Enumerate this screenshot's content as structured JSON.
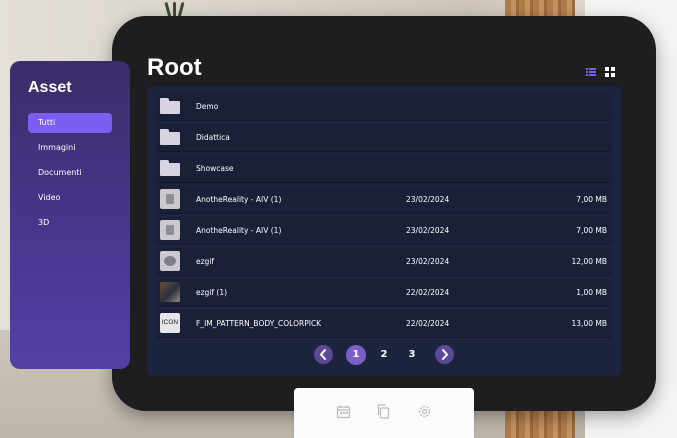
{
  "sidebar": {
    "title": "Asset",
    "items": [
      {
        "label": "Tutti",
        "active": true
      },
      {
        "label": "Immagini",
        "active": false
      },
      {
        "label": "Documenti",
        "active": false
      },
      {
        "label": "Video",
        "active": false
      },
      {
        "label": "3D",
        "active": false
      }
    ]
  },
  "header": {
    "title": "Root",
    "view_icons": [
      "list-view-icon",
      "grid-view-icon"
    ]
  },
  "files": [
    {
      "name": "Demo",
      "date": "",
      "size": "",
      "type": "folder"
    },
    {
      "name": "Didattica",
      "date": "",
      "size": "",
      "type": "folder"
    },
    {
      "name": "Showcase",
      "date": "",
      "size": "",
      "type": "folder"
    },
    {
      "name": "AnotheReality - AIV (1)",
      "date": "23/02/2024",
      "size": "7,00 MB",
      "type": "file"
    },
    {
      "name": "AnotheReality - AIV (1)",
      "date": "23/02/2024",
      "size": "7,00 MB",
      "type": "file"
    },
    {
      "name": "ezgif",
      "date": "23/02/2024",
      "size": "12,00 MB",
      "type": "gif"
    },
    {
      "name": "ezgif (1)",
      "date": "22/02/2024",
      "size": "1,00 MB",
      "type": "image"
    },
    {
      "name": "F_IM_PATTERN_BODY_COLORPICK",
      "date": "22/02/2024",
      "size": "13,00 MB",
      "type": "icon",
      "thumb_text": "ICON"
    }
  ],
  "pagination": {
    "pages": [
      "1",
      "2",
      "3"
    ],
    "current": "1",
    "prev_icon": "chevron-left-icon",
    "next_icon": "chevron-right-icon"
  },
  "bottom_bar": {
    "icons": [
      "calendar-icon",
      "copy-icon",
      "settings-icon"
    ]
  },
  "colors": {
    "accent": "#7c5ff2",
    "sidebar": "#4a3790",
    "panel": "#1d2440",
    "tablet": "#1e1e20"
  }
}
